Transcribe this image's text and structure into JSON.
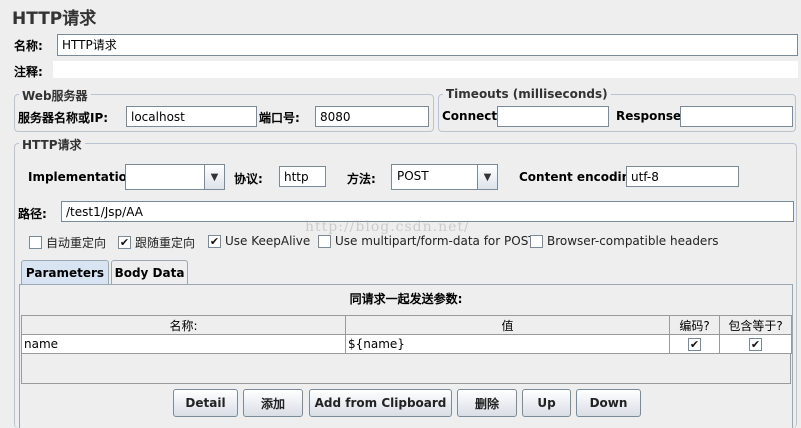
{
  "title": "HTTP请求",
  "name_label": "名称:",
  "name_value": "HTTP请求",
  "comment_label": "注释:",
  "comment_value": "",
  "web_server": {
    "legend": "Web服务器",
    "server_label": "服务器名称或IP:",
    "server_value": "localhost",
    "port_label": "端口号:",
    "port_value": "8080"
  },
  "timeouts": {
    "legend": "Timeouts (milliseconds)",
    "connect_label": "Connect:",
    "connect_value": "",
    "response_label": "Response:",
    "response_value": ""
  },
  "http_request": {
    "legend": "HTTP请求",
    "implementation_label": "Implementation:",
    "implementation_value": "",
    "protocol_label": "协议:",
    "protocol_value": "http",
    "method_label": "方法:",
    "method_value": "POST",
    "encoding_label": "Content encoding:",
    "encoding_value": "utf-8",
    "path_label": "路径:",
    "path_value": "/test1/Jsp/AA"
  },
  "options": [
    {
      "label": "自动重定向",
      "checked": false
    },
    {
      "label": "跟随重定向",
      "checked": true
    },
    {
      "label": "Use KeepAlive",
      "checked": true
    },
    {
      "label": "Use multipart/form-data for POST",
      "checked": false
    },
    {
      "label": "Browser-compatible headers",
      "checked": false
    }
  ],
  "check_glyph": "✔",
  "tabs": {
    "parameters": "Parameters",
    "body_data": "Body Data"
  },
  "params": {
    "heading": "同请求一起发送参数:",
    "columns": [
      "名称:",
      "值",
      "编码?",
      "包含等于?"
    ],
    "rows": [
      {
        "name": "name",
        "value": "${name}",
        "encode": true,
        "include_equals": true
      }
    ]
  },
  "buttons": {
    "detail": "Detail",
    "add": "添加",
    "add_clipboard": "Add from Clipboard",
    "delete": "删除",
    "up": "Up",
    "down": "Down"
  },
  "watermark": "http://blog.csdn.net/",
  "colors": {
    "background": "#eeeeee",
    "active_tab": "#d8e4f2",
    "field_border": "#7a8a99"
  }
}
